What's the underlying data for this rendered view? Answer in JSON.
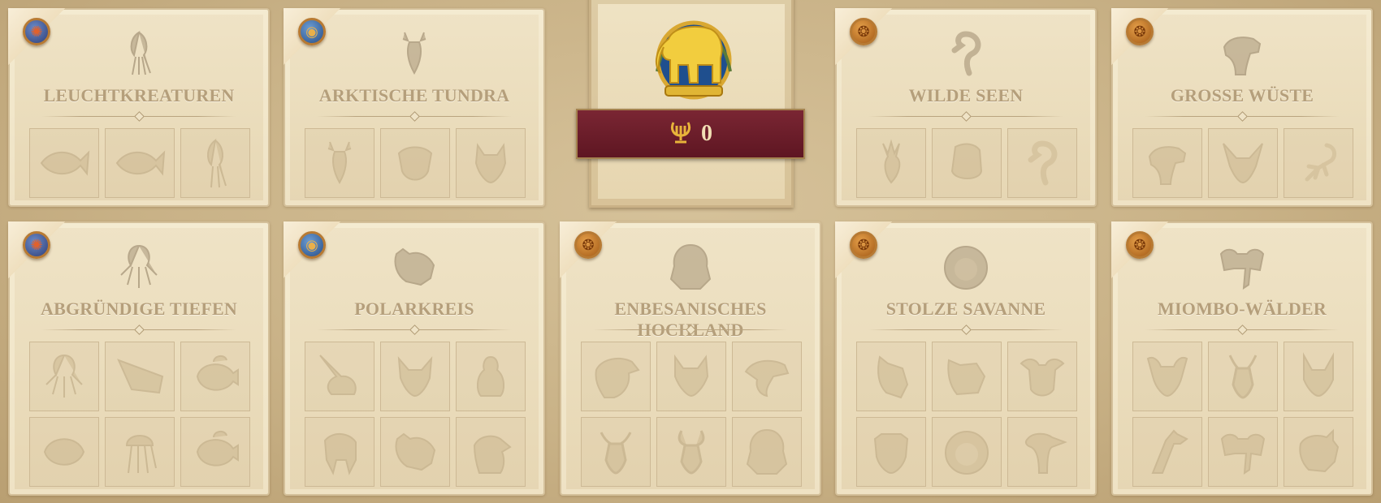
{
  "center": {
    "score": "0",
    "medal_icon": "golden-elephant-icon",
    "score_icon": "lyre-icon"
  },
  "colors": {
    "ribbon": "#6b1d2a",
    "title": "#b59f7b",
    "gold": "#e0b83c"
  },
  "panels": [
    {
      "title": "LEUCHTKREATUREN",
      "region": "sea",
      "head": "squid",
      "slots": [
        "fish",
        "fish",
        "squid"
      ]
    },
    {
      "title": "ARKTISCHE TUNDRA",
      "region": "polar",
      "head": "reindeer",
      "slots": [
        "reindeer",
        "muskox",
        "wolf"
      ]
    },
    {
      "title": "WILDE SEEN",
      "region": "africa",
      "head": "flamingo",
      "slots": [
        "crowned-crane",
        "hippo",
        "flamingo"
      ]
    },
    {
      "title": "GROSSE WÜSTE",
      "region": "africa",
      "head": "camel",
      "slots": [
        "camel",
        "fennec-fox",
        "scorpion"
      ]
    },
    {
      "title": "ABGRÜNDIGE TIEFEN",
      "region": "sea",
      "head": "octopus",
      "slots": [
        "octopus",
        "shark",
        "anglerfish",
        "fish",
        "jellyfish",
        "anglerfish"
      ]
    },
    {
      "title": "POLARKREIS",
      "region": "polar",
      "head": "polar-bear",
      "slots": [
        "narwhal",
        "arctic-fox",
        "penguin",
        "walrus",
        "polar-bear",
        "seal"
      ]
    },
    {
      "title": "ENBESANISCHES HOCHLAND",
      "region": "africa",
      "head": "gelada",
      "slots": [
        "eagle",
        "wolf",
        "chameleon",
        "antelope",
        "ibex",
        "gelada"
      ]
    },
    {
      "title": "STOLZE SAVANNE",
      "region": "africa",
      "head": "lion",
      "slots": [
        "zebra",
        "hyena",
        "buffalo",
        "cheetah",
        "lion",
        "ostrich"
      ]
    },
    {
      "title": "MIOMBO-WÄLDER",
      "region": "africa",
      "head": "elephant",
      "slots": [
        "wild-dog",
        "antelope",
        "caracal",
        "giraffe",
        "elephant",
        "rhino"
      ]
    }
  ]
}
